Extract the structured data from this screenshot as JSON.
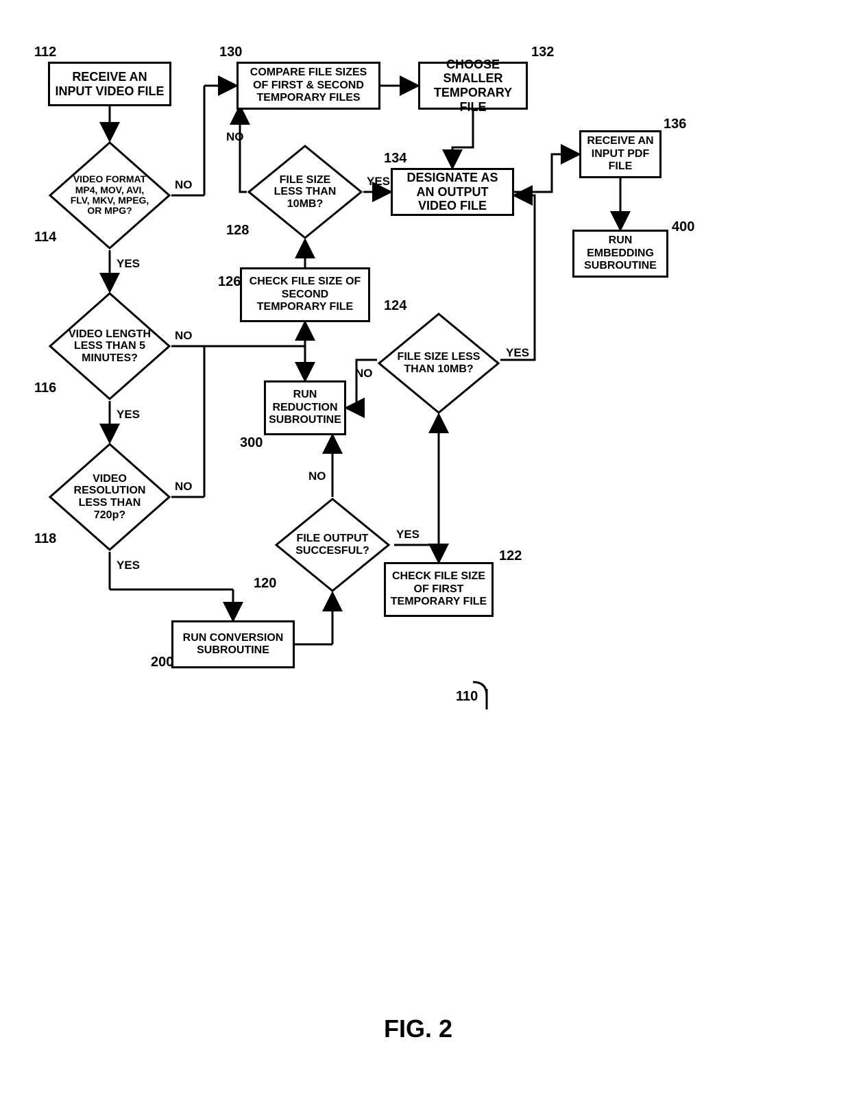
{
  "figure_label": "FIG. 2",
  "entry_node_ref_number": "110",
  "boxes": {
    "b112": {
      "text": "RECEIVE AN INPUT VIDEO FILE",
      "ref": "112"
    },
    "b130": {
      "text": "COMPARE FILE SIZES OF FIRST & SECOND TEMPORARY FILES",
      "ref": "130"
    },
    "b132": {
      "text": "CHOOSE SMALLER TEMPORARY FILE",
      "ref": "132"
    },
    "b134": {
      "text": "DESIGNATE AS AN OUTPUT VIDEO FILE",
      "ref": "134"
    },
    "b136": {
      "text": "RECEIVE AN INPUT PDF FILE",
      "ref": "136"
    },
    "b400": {
      "text": "RUN EMBEDDING SUBROUTINE",
      "ref": "400"
    },
    "b126": {
      "text": "CHECK FILE SIZE OF SECOND TEMPORARY FILE",
      "ref": "126"
    },
    "b300": {
      "text": "RUN REDUCTION SUBROUTINE",
      "ref": "300"
    },
    "b122": {
      "text": "CHECK FILE SIZE OF FIRST TEMPORARY FILE",
      "ref": "122"
    },
    "b200": {
      "text": "RUN CONVERSION SUBROUTINE",
      "ref": "200"
    }
  },
  "diamonds": {
    "d114": {
      "text": "VIDEO FORMAT MP4, MOV, AVI, FLV, MKV, MPEG, OR MPG?",
      "ref": "114"
    },
    "d116": {
      "text": "VIDEO LENGTH LESS THAN 5 MINUTES?",
      "ref": "116"
    },
    "d118": {
      "text": "VIDEO RESOLUTION LESS THAN 720p?",
      "ref": "118"
    },
    "d128": {
      "text": "FILE SIZE LESS THAN 10MB?",
      "ref": "128"
    },
    "d124": {
      "text": "FILE SIZE LESS THAN 10MB?",
      "ref": "124"
    },
    "d120": {
      "text": "FILE OUTPUT SUCCESFUL?",
      "ref": "120"
    }
  },
  "edge_labels": {
    "d114_yes": "YES",
    "d114_no": "NO",
    "d116_yes": "YES",
    "d116_no": "NO",
    "d118_yes": "YES",
    "d118_no": "NO",
    "d128_yes": "YES",
    "d128_no": "NO",
    "d124_yes": "YES",
    "d124_no": "NO",
    "d120_yes": "YES",
    "d120_no": "NO"
  },
  "chart_data": {
    "type": "flowchart",
    "title": "FIG. 2",
    "nodes": [
      {
        "id": "110",
        "type": "entry",
        "label": ""
      },
      {
        "id": "112",
        "type": "process",
        "label": "RECEIVE AN INPUT VIDEO FILE"
      },
      {
        "id": "114",
        "type": "decision",
        "label": "VIDEO FORMAT MP4, MOV, AVI, FLV, MKV, MPEG, OR MPG?"
      },
      {
        "id": "116",
        "type": "decision",
        "label": "VIDEO LENGTH LESS THAN 5 MINUTES?"
      },
      {
        "id": "118",
        "type": "decision",
        "label": "VIDEO RESOLUTION LESS THAN 720p?"
      },
      {
        "id": "200",
        "type": "process",
        "label": "RUN CONVERSION SUBROUTINE"
      },
      {
        "id": "120",
        "type": "decision",
        "label": "FILE OUTPUT SUCCESFUL?"
      },
      {
        "id": "122",
        "type": "process",
        "label": "CHECK FILE SIZE OF FIRST TEMPORARY FILE"
      },
      {
        "id": "124",
        "type": "decision",
        "label": "FILE SIZE LESS THAN 10MB?"
      },
      {
        "id": "300",
        "type": "process",
        "label": "RUN REDUCTION SUBROUTINE"
      },
      {
        "id": "126",
        "type": "process",
        "label": "CHECK FILE SIZE OF SECOND TEMPORARY FILE"
      },
      {
        "id": "128",
        "type": "decision",
        "label": "FILE SIZE LESS THAN 10MB?"
      },
      {
        "id": "130",
        "type": "process",
        "label": "COMPARE FILE SIZES OF FIRST & SECOND TEMPORARY FILES"
      },
      {
        "id": "132",
        "type": "process",
        "label": "CHOOSE SMALLER TEMPORARY FILE"
      },
      {
        "id": "134",
        "type": "process",
        "label": "DESIGNATE AS AN OUTPUT VIDEO FILE"
      },
      {
        "id": "136",
        "type": "process",
        "label": "RECEIVE AN INPUT PDF FILE"
      },
      {
        "id": "400",
        "type": "process",
        "label": "RUN EMBEDDING SUBROUTINE"
      }
    ],
    "edges": [
      {
        "from": "110",
        "to": "112"
      },
      {
        "from": "112",
        "to": "114"
      },
      {
        "from": "114",
        "to": "116",
        "label": "YES"
      },
      {
        "from": "114",
        "to": "130",
        "label": "NO"
      },
      {
        "from": "116",
        "to": "118",
        "label": "YES"
      },
      {
        "from": "116",
        "to": "300",
        "label": "NO"
      },
      {
        "from": "118",
        "to": "200",
        "label": "YES"
      },
      {
        "from": "118",
        "to": "300",
        "label": "NO"
      },
      {
        "from": "200",
        "to": "120"
      },
      {
        "from": "120",
        "to": "122",
        "label": "YES"
      },
      {
        "from": "120",
        "to": "300",
        "label": "NO"
      },
      {
        "from": "122",
        "to": "124"
      },
      {
        "from": "124",
        "to": "134",
        "label": "YES"
      },
      {
        "from": "124",
        "to": "300",
        "label": "NO"
      },
      {
        "from": "300",
        "to": "126"
      },
      {
        "from": "126",
        "to": "128"
      },
      {
        "from": "128",
        "to": "134",
        "label": "YES"
      },
      {
        "from": "128",
        "to": "130",
        "label": "NO"
      },
      {
        "from": "130",
        "to": "132"
      },
      {
        "from": "132",
        "to": "134"
      },
      {
        "from": "134",
        "to": "136"
      },
      {
        "from": "136",
        "to": "400"
      }
    ]
  }
}
